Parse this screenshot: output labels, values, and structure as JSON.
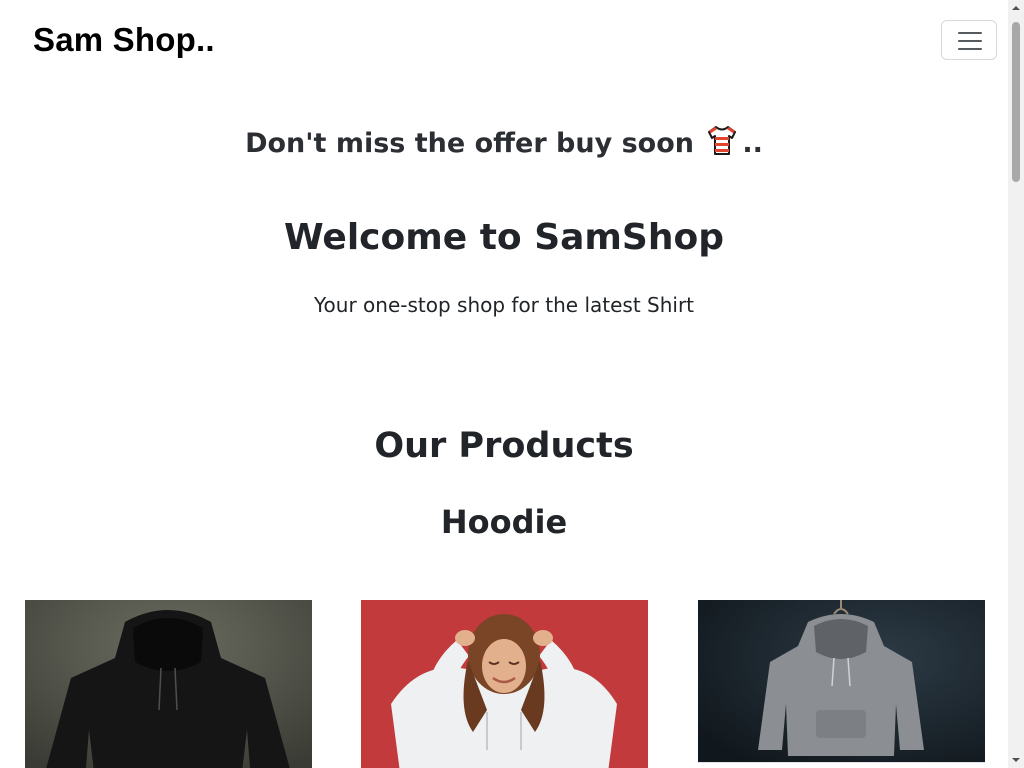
{
  "navbar": {
    "brand": "Sam Shop..",
    "toggle_icon": "hamburger-menu-icon"
  },
  "hero": {
    "offer_text": "Don't miss the offer buy soon",
    "offer_icon": "t-shirt-emoji-icon",
    "offer_suffix": "..",
    "welcome": "Welcome to SamShop",
    "tagline": "Your one-stop shop for the latest Shirt"
  },
  "products": {
    "title": "Our Products",
    "category": "Hoodie",
    "items": [
      {
        "image": "black-hoodie-image"
      },
      {
        "image": "woman-in-white-hoodie-image"
      },
      {
        "image": "grey-hoodie-on-hanger-image"
      }
    ]
  },
  "colors": {
    "text": "#212529",
    "brand": "#000000",
    "card2_bg": "#c23a3c",
    "card3_bg": "#1a242c"
  }
}
